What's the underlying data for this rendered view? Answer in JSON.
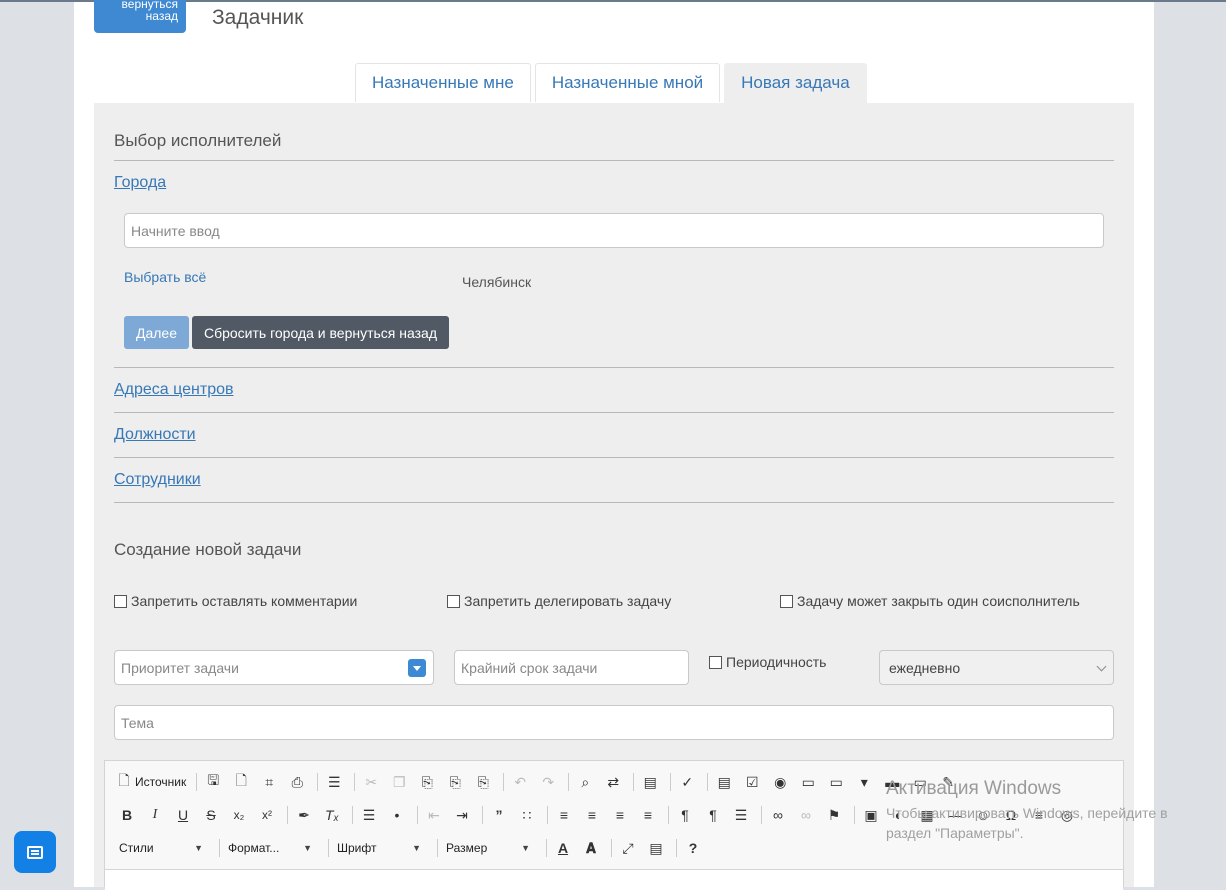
{
  "header": {
    "back_line1": "вернуться",
    "back_line2": "назад",
    "title": "Задачник"
  },
  "tabs": [
    {
      "label": "Назначенные мне",
      "active": false
    },
    {
      "label": "Назначенные мной",
      "active": false
    },
    {
      "label": "Новая задача",
      "active": true
    }
  ],
  "executors": {
    "title": "Выбор исполнителей",
    "cities_link": "Города",
    "search_placeholder": "Начните ввод",
    "select_all": "Выбрать всё",
    "city": "Челябинск",
    "next_button": "Далее",
    "reset_button": "Сбросить города и вернуться назад",
    "addresses_link": "Адреса центров",
    "positions_link": "Должности",
    "employees_link": "Сотрудники"
  },
  "new_task": {
    "title": "Создание новой задачи",
    "checkbox_comments": "Запретить оставлять комментарии",
    "checkbox_delegate": "Запретить делегировать задачу",
    "checkbox_close": "Задачу может закрыть один соисполнитель",
    "priority_placeholder": "Приоритет задачи",
    "deadline_placeholder": "Крайний срок задачи",
    "periodic_label": "Периодичность",
    "periodic_value": "ежедневно",
    "subject_placeholder": "Тема"
  },
  "editor": {
    "source_label": "Источник",
    "styles_label": "Стили",
    "format_label": "Формат...",
    "font_label": "Шрифт",
    "size_label": "Размер"
  },
  "watermark": {
    "line1": "Активация Windows",
    "line2": "Чтобы активировать Windows, перейдите в раздел \"Параметры\"."
  },
  "colors": {
    "accent": "#3f89d2",
    "link": "#3778b6",
    "panel": "#eeeeee",
    "reset_button": "#515a64"
  }
}
